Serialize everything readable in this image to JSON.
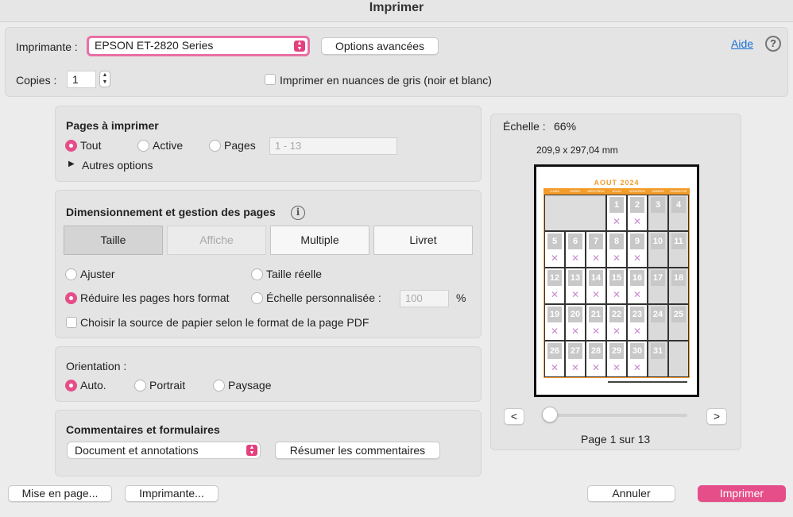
{
  "window": {
    "title": "Imprimer"
  },
  "printer": {
    "label": "Imprimante :",
    "value": "EPSON ET-2820 Series",
    "advanced_button": "Options avancées",
    "help_link": "Aide",
    "help_icon": "?"
  },
  "copies": {
    "label": "Copies :",
    "value": "1",
    "grayscale_label": "Imprimer en nuances de gris (noir et blanc)"
  },
  "pages": {
    "heading": "Pages à imprimer",
    "options": [
      "Tout",
      "Active",
      "Pages"
    ],
    "selected": "Tout",
    "range_placeholder": "1 - 13",
    "more_options": "Autres options"
  },
  "sizing": {
    "heading": "Dimensionnement et gestion des pages",
    "info_icon": "i",
    "modes": [
      "Taille",
      "Affiche",
      "Multiple",
      "Livret"
    ],
    "selected_mode": "Taille",
    "fit": "Ajuster",
    "actual": "Taille réelle",
    "shrink": "Réduire les pages hors format",
    "custom_scale": "Échelle personnalisée :",
    "custom_value": "100",
    "percent": "%",
    "paper_source": "Choisir la source de papier selon le format de la page PDF"
  },
  "orientation": {
    "heading": "Orientation :",
    "options": [
      "Auto.",
      "Portrait",
      "Paysage"
    ],
    "selected": "Auto."
  },
  "comments": {
    "heading": "Commentaires et formulaires",
    "value": "Document et annotations",
    "summary_button": "Résumer les commentaires"
  },
  "preview": {
    "scale_label": "Échelle :",
    "scale_value": "66%",
    "dimensions": "209,9 x 297,04 mm",
    "doc_title": "AOUT 2024",
    "weekdays": [
      "LUNDI",
      "MARDI",
      "MERCREDI",
      "JEUDI",
      "VENDREDI",
      "SAMEDI",
      "DIMANCHE"
    ],
    "days": [
      "1",
      "2",
      "3",
      "4",
      "5",
      "6",
      "7",
      "8",
      "9",
      "10",
      "11",
      "12",
      "13",
      "14",
      "15",
      "16",
      "17",
      "18",
      "19",
      "20",
      "21",
      "22",
      "23",
      "24",
      "25",
      "26",
      "27",
      "28",
      "29",
      "30",
      "31"
    ],
    "prev": "<",
    "next": ">",
    "page_status": "Page 1 sur 13",
    "zoom_level": 0
  },
  "footer": {
    "page_setup": "Mise en page...",
    "printer_button": "Imprimante...",
    "cancel": "Annuler",
    "print": "Imprimer"
  },
  "colors": {
    "accent": "#e54e89",
    "calendar_accent": "#f39c2a"
  }
}
